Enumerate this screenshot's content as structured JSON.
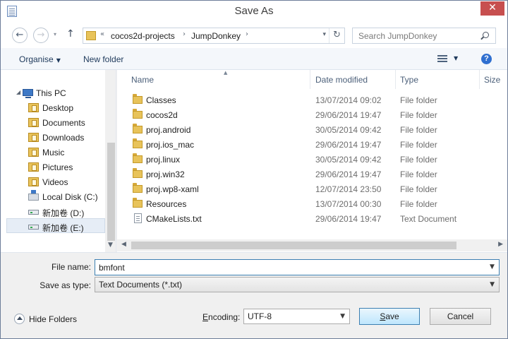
{
  "window": {
    "title": "Save As",
    "close_glyph": "✕",
    "icon": "notepad-icon"
  },
  "address": {
    "breadcrumb_prefix": "«",
    "crumbs": [
      "cocos2d-projects",
      "JumpDonkey"
    ],
    "separator": "›",
    "search_placeholder": "Search JumpDonkey"
  },
  "toolbar": {
    "organise_label": "Organise",
    "new_folder_label": "New folder",
    "view_icon": "details-view-icon",
    "help_glyph": "?"
  },
  "nav": {
    "items": [
      {
        "label": "This PC",
        "icon": "computer-icon"
      },
      {
        "label": "Desktop",
        "icon": "library-icon"
      },
      {
        "label": "Documents",
        "icon": "library-icon"
      },
      {
        "label": "Downloads",
        "icon": "library-icon"
      },
      {
        "label": "Music",
        "icon": "library-icon"
      },
      {
        "label": "Pictures",
        "icon": "library-icon"
      },
      {
        "label": "Videos",
        "icon": "library-icon"
      },
      {
        "label": "Local Disk (C:)",
        "icon": "system-drive-icon"
      },
      {
        "label": "新加卷 (D:)",
        "icon": "drive-icon"
      },
      {
        "label": "新加卷 (E:)",
        "icon": "drive-icon"
      }
    ]
  },
  "columns": [
    "Name",
    "Date modified",
    "Type",
    "Size"
  ],
  "files": [
    {
      "name": "Classes",
      "date": "13/07/2014 09:02",
      "type": "File folder",
      "icon": "folder-icon"
    },
    {
      "name": "cocos2d",
      "date": "29/06/2014 19:47",
      "type": "File folder",
      "icon": "folder-icon"
    },
    {
      "name": "proj.android",
      "date": "30/05/2014 09:42",
      "type": "File folder",
      "icon": "folder-icon"
    },
    {
      "name": "proj.ios_mac",
      "date": "29/06/2014 19:47",
      "type": "File folder",
      "icon": "folder-icon"
    },
    {
      "name": "proj.linux",
      "date": "30/05/2014 09:42",
      "type": "File folder",
      "icon": "folder-icon"
    },
    {
      "name": "proj.win32",
      "date": "29/06/2014 19:47",
      "type": "File folder",
      "icon": "folder-icon"
    },
    {
      "name": "proj.wp8-xaml",
      "date": "12/07/2014 23:50",
      "type": "File folder",
      "icon": "folder-icon"
    },
    {
      "name": "Resources",
      "date": "13/07/2014 00:30",
      "type": "File folder",
      "icon": "folder-icon"
    },
    {
      "name": "CMakeLists.txt",
      "date": "29/06/2014 19:47",
      "type": "Text Document",
      "icon": "text-file-icon"
    }
  ],
  "form": {
    "file_name_label": "File name:",
    "file_name_value": "bmfont",
    "save_as_type_label": "Save as type:",
    "save_as_type_value": "Text Documents (*.txt)",
    "encoding_label": "Encoding:",
    "encoding_value": "UTF-8"
  },
  "footer": {
    "hide_folders_label": "Hide Folders",
    "save_label": "Save",
    "cancel_label": "Cancel"
  }
}
